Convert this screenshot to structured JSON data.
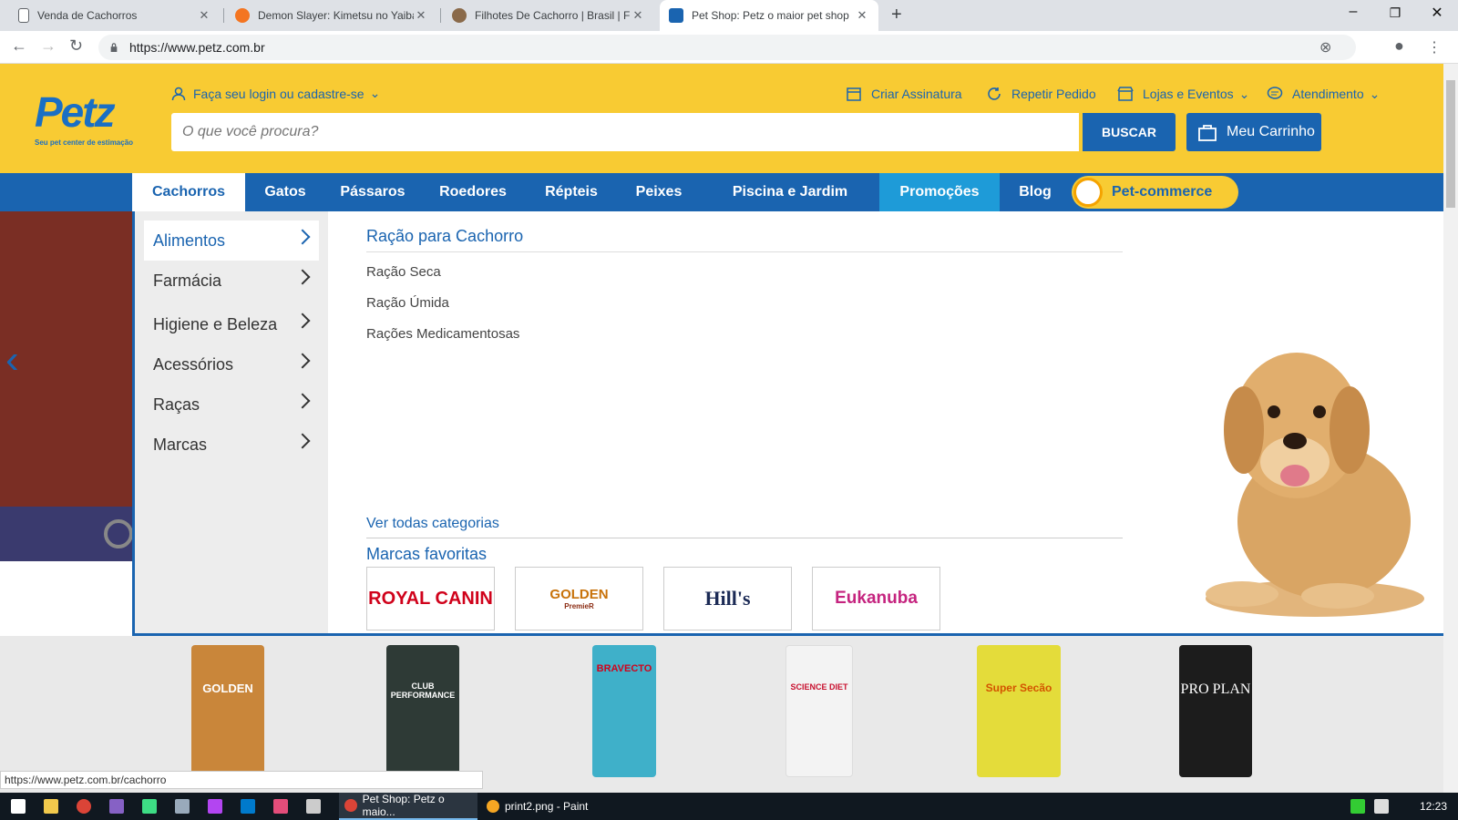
{
  "browser": {
    "tabs": [
      {
        "title": "Venda de Cachorros",
        "active": false
      },
      {
        "title": "Demon Slayer: Kimetsu no Yaiba",
        "active": false
      },
      {
        "title": "Filhotes De Cachorro | Brasil | Filh",
        "active": false
      },
      {
        "title": "Pet Shop: Petz o maior pet shop",
        "active": true
      }
    ],
    "new_tab": "+",
    "url": "https://www.petz.com.br",
    "window_controls": [
      "–",
      "❐",
      "✕"
    ]
  },
  "header": {
    "logo_text": "Petz",
    "logo_tagline": "Seu pet center de estimação",
    "login": "Faça seu login ou cadastre-se",
    "links": [
      {
        "label": "Criar Assinatura",
        "icon": "calendar-icon"
      },
      {
        "label": "Repetir Pedido",
        "icon": "refresh-icon"
      },
      {
        "label": "Lojas e Eventos",
        "icon": "store-icon"
      },
      {
        "label": "Atendimento",
        "icon": "chat-icon"
      }
    ],
    "search_placeholder": "O que você procura?",
    "search_button": "BUSCAR",
    "cart": "Meu Carrinho"
  },
  "nav": {
    "items": [
      "Cachorros",
      "Gatos",
      "Pássaros",
      "Roedores",
      "Répteis",
      "Peixes",
      "Piscina e Jardim",
      "Promoções",
      "Blog"
    ],
    "active": "Cachorros",
    "pet_commerce": "Pet-commerce"
  },
  "dropdown": {
    "menu": [
      "Alimentos",
      "Farmácia",
      "Higiene e Beleza",
      "Acessórios",
      "Raças",
      "Marcas"
    ],
    "active": "Alimentos",
    "section_title": "Ração para Cachorro",
    "links": [
      "Ração Seca",
      "Ração Úmida",
      "Rações Medicamentosas"
    ],
    "all_categories": "Ver todas categorias",
    "favorites_title": "Marcas favoritas",
    "brands": [
      "ROYAL CANIN",
      "GOLDEN",
      "Hill's",
      "Eukanuba"
    ],
    "brand_sub": {
      "golden": "PremieR"
    }
  },
  "products": [
    "GOLDEN",
    "CLUB PERFORMANCE",
    "BRAVECTO",
    "SCIENCE DIET",
    "Super Secão",
    "PRO PLAN"
  ],
  "status_url": "https://www.petz.com.br/cachorro",
  "taskbar": {
    "apps": [
      {
        "label": "Pet Shop: Petz o maio...",
        "active": true
      },
      {
        "label": "print2.png - Paint",
        "active": false
      }
    ],
    "time": "12:23"
  },
  "colors": {
    "brand_blue": "#1a64b0",
    "brand_yellow": "#f8cb33",
    "promo_blue": "#1e9bd8"
  }
}
